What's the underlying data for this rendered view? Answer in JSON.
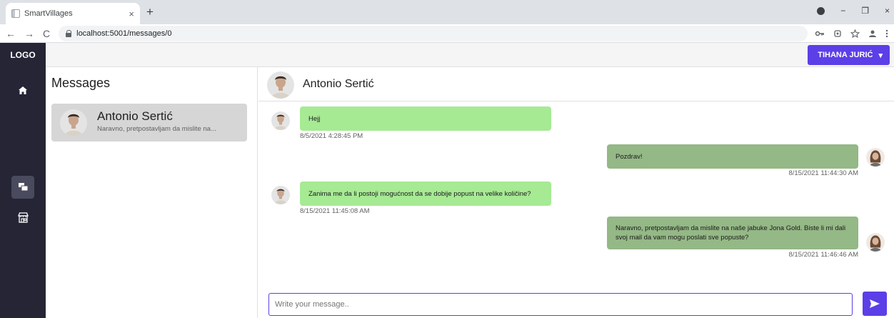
{
  "browser": {
    "tab_title": "SmartVillages",
    "tab_close": "×",
    "new_tab": "+",
    "url": "localhost:5001/messages/0",
    "back": "←",
    "forward": "→",
    "reload": "C",
    "win_minimize": "−",
    "win_maximize": "❐",
    "win_close": "×"
  },
  "app": {
    "logo": "LOGO",
    "user_name": "TIHANA JURIĆ",
    "user_caret": "▾"
  },
  "left_panel": {
    "title": "Messages",
    "conversations": [
      {
        "name": "Antonio Sertić",
        "preview": "Naravno, pretpostavljam da mislite na..."
      }
    ]
  },
  "chat": {
    "contact_name": "Antonio Sertić",
    "messages": [
      {
        "direction": "in",
        "text": "Hejj",
        "time": "8/5/2021 4:28:45 PM"
      },
      {
        "direction": "out",
        "text": "Pozdrav!",
        "time": "8/15/2021 11:44:30 AM"
      },
      {
        "direction": "in",
        "text": "Zanima me da li postoji mogućnost da se dobije popust na velike količine?",
        "time": "8/15/2021 11:45:08 AM"
      },
      {
        "direction": "out",
        "text_line1": "Naravno, pretpostavljam da mislite na naše jabuke Jona Gold. Biste li mi dali",
        "text_line2": "svoj mail da vam mogu poslati sve popuste?",
        "time": "8/15/2021 11:46:46 AM"
      }
    ],
    "input_placeholder": "Write your message.."
  },
  "colors": {
    "accent": "#5c3fe7",
    "sidebar": "#252536",
    "incoming_bubble": "#a6ea94",
    "outgoing_bubble": "#94b886"
  },
  "icons": [
    "home-icon",
    "chat-icon",
    "store-icon",
    "send-icon",
    "lock-icon",
    "key-icon",
    "star-icon",
    "profile-icon"
  ]
}
